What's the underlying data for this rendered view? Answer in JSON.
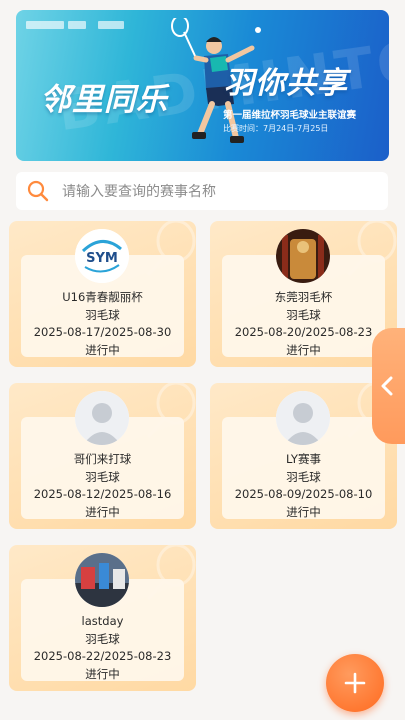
{
  "banner": {
    "slogan_left": "邻里同乐",
    "slogan_right": "羽你共享",
    "event_name": "第一届维拉杯羽毛球业主联谊赛",
    "event_time": "比赛时间：7月24日-7月25日",
    "bg_word": "BADMINTON"
  },
  "search": {
    "placeholder": "请输入要查询的赛事名称"
  },
  "events": [
    {
      "name": "U16青春靓丽杯",
      "sport": "羽毛球",
      "dates": "2025-08-17/2025-08-30",
      "status": "进行中",
      "avatar": "sym-logo"
    },
    {
      "name": "东莞羽毛杯",
      "sport": "羽毛球",
      "dates": "2025-08-20/2025-08-23",
      "status": "进行中",
      "avatar": "temple-photo"
    },
    {
      "name": "哥们来打球",
      "sport": "羽毛球",
      "dates": "2025-08-12/2025-08-16",
      "status": "进行中",
      "avatar": "default-avatar"
    },
    {
      "name": "LY赛事",
      "sport": "羽毛球",
      "dates": "2025-08-09/2025-08-10",
      "status": "进行中",
      "avatar": "default-avatar"
    },
    {
      "name": "lastday",
      "sport": "羽毛球",
      "dates": "2025-08-22/2025-08-23",
      "status": "进行中",
      "avatar": "gym-photo"
    }
  ],
  "colors": {
    "accent": "#ff6a1f",
    "card_bg": "#ffe2b6",
    "search_icon": "#ff8a3d"
  },
  "icons": {
    "search": "search-icon",
    "add": "plus-icon",
    "side": "chevron-left-icon"
  }
}
